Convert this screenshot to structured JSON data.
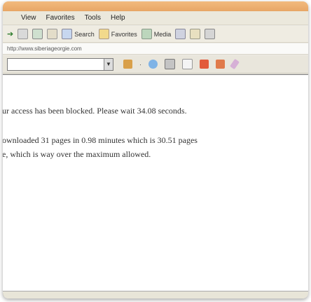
{
  "menubar": {
    "items": [
      "View",
      "Favorites",
      "Tools",
      "Help"
    ]
  },
  "toolbar": {
    "search_label": "Search",
    "favorites_label": "Favorites",
    "media_label": "Media"
  },
  "address": {
    "url": "http://www.siberiageorgie.com"
  },
  "content": {
    "line1": "ur access has been blocked. Please wait 34.08 seconds.",
    "line2": "ownloaded 31 pages in 0.98 minutes which is 30.51 pages",
    "line3": "e, which is way over the maximum allowed."
  },
  "colors": {
    "accent": "#e79a4f"
  }
}
